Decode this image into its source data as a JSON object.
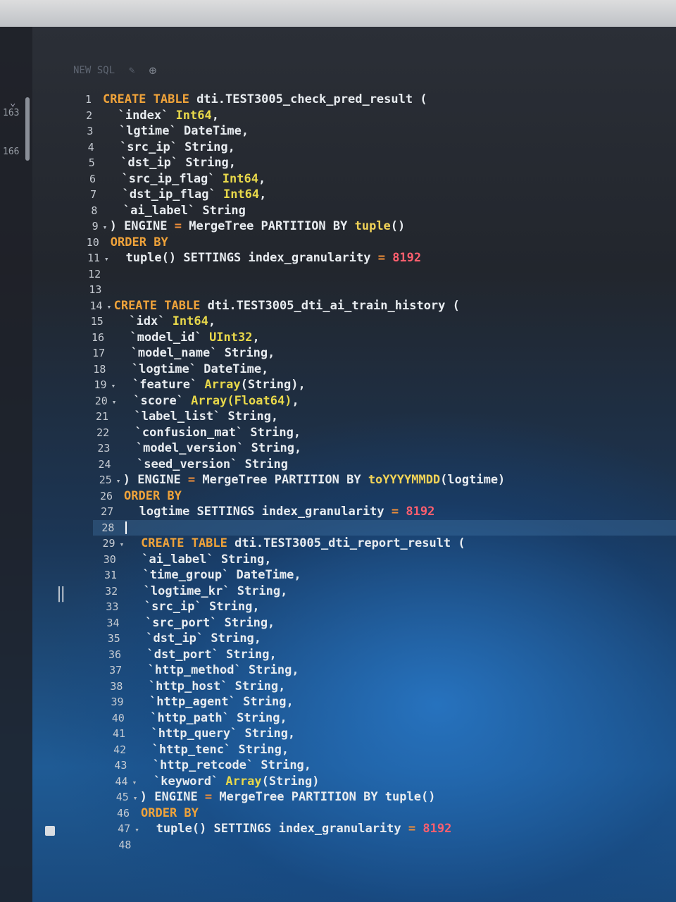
{
  "tab": {
    "label": "NEW SQL",
    "add_icon": "plus-circle-icon"
  },
  "left_panel": {
    "numbers": [
      "163",
      "166"
    ]
  },
  "editor": {
    "lines": [
      {
        "n": "1",
        "fold": "",
        "segs": [
          [
            "kw",
            "CREATE TABLE "
          ],
          [
            "code",
            "dti.TEST3005_check_pred_result ("
          ]
        ]
      },
      {
        "n": "2",
        "fold": "",
        "segs": [
          [
            "code",
            "  `index` "
          ],
          [
            "ty",
            "Int64"
          ],
          [
            "code",
            ","
          ]
        ]
      },
      {
        "n": "3",
        "fold": "",
        "segs": [
          [
            "code",
            "  `lgtime` DateTime,"
          ]
        ]
      },
      {
        "n": "4",
        "fold": "",
        "segs": [
          [
            "code",
            "  `src_ip` String,"
          ]
        ]
      },
      {
        "n": "5",
        "fold": "",
        "segs": [
          [
            "code",
            "  `dst_ip` String,"
          ]
        ]
      },
      {
        "n": "6",
        "fold": "",
        "segs": [
          [
            "code",
            "  `src_ip_flag` "
          ],
          [
            "ty",
            "Int64"
          ],
          [
            "code",
            ","
          ]
        ]
      },
      {
        "n": "7",
        "fold": "",
        "segs": [
          [
            "code",
            "  `dst_ip_flag` "
          ],
          [
            "ty",
            "Int64"
          ],
          [
            "code",
            ","
          ]
        ]
      },
      {
        "n": "8",
        "fold": "",
        "segs": [
          [
            "code",
            "  `ai_label` String"
          ]
        ]
      },
      {
        "n": "9",
        "fold": "▾",
        "segs": [
          [
            "code",
            ") ENGINE "
          ],
          [
            "op",
            "="
          ],
          [
            "code",
            " MergeTree PARTITION BY "
          ],
          [
            "fn",
            "tuple"
          ],
          [
            "code",
            "()"
          ]
        ]
      },
      {
        "n": "10",
        "fold": "",
        "segs": [
          [
            "kw",
            "ORDER BY"
          ]
        ]
      },
      {
        "n": "11",
        "fold": "▾",
        "segs": [
          [
            "code",
            "  tuple() SETTINGS index_granularity "
          ],
          [
            "op",
            "="
          ],
          [
            "num",
            " 8192"
          ]
        ]
      },
      {
        "n": "12",
        "fold": "",
        "segs": []
      },
      {
        "n": "13",
        "fold": "",
        "segs": []
      },
      {
        "n": "14",
        "fold": "▾",
        "segs": [
          [
            "kw",
            "CREATE TABLE "
          ],
          [
            "code",
            "dti.TEST3005_dti_ai_train_history ("
          ]
        ]
      },
      {
        "n": "15",
        "fold": "",
        "segs": [
          [
            "code",
            "  `idx` "
          ],
          [
            "ty",
            "Int64"
          ],
          [
            "code",
            ","
          ]
        ]
      },
      {
        "n": "16",
        "fold": "",
        "segs": [
          [
            "code",
            "  `model_id` "
          ],
          [
            "ty",
            "UInt32"
          ],
          [
            "code",
            ","
          ]
        ]
      },
      {
        "n": "17",
        "fold": "",
        "segs": [
          [
            "code",
            "  `model_name` String,"
          ]
        ]
      },
      {
        "n": "18",
        "fold": "",
        "segs": [
          [
            "code",
            "  `logtime` DateTime,"
          ]
        ]
      },
      {
        "n": "19",
        "fold": "▾",
        "segs": [
          [
            "code",
            "  `feature` "
          ],
          [
            "ty",
            "Array"
          ],
          [
            "code",
            "(String),"
          ]
        ]
      },
      {
        "n": "20",
        "fold": "▾",
        "segs": [
          [
            "code",
            "  `score` "
          ],
          [
            "ty",
            "Array(Float64)"
          ],
          [
            "code",
            ","
          ]
        ]
      },
      {
        "n": "21",
        "fold": "",
        "segs": [
          [
            "code",
            "  `label_list` String,"
          ]
        ]
      },
      {
        "n": "22",
        "fold": "",
        "segs": [
          [
            "code",
            "  `confusion_mat` String,"
          ]
        ]
      },
      {
        "n": "23",
        "fold": "",
        "segs": [
          [
            "code",
            "  `model_version` String,"
          ]
        ]
      },
      {
        "n": "24",
        "fold": "",
        "segs": [
          [
            "code",
            "  `seed_version` String"
          ]
        ]
      },
      {
        "n": "25",
        "fold": "▾",
        "segs": [
          [
            "code",
            ") ENGINE "
          ],
          [
            "op",
            "="
          ],
          [
            "code",
            " MergeTree PARTITION BY "
          ],
          [
            "fn",
            "toYYYYMMDD"
          ],
          [
            "code",
            "(logtime)"
          ]
        ]
      },
      {
        "n": "26",
        "fold": "",
        "segs": [
          [
            "kw",
            "ORDER BY"
          ]
        ]
      },
      {
        "n": "27",
        "fold": "",
        "segs": [
          [
            "code",
            "  logtime SETTINGS index_granularity "
          ],
          [
            "op",
            "="
          ],
          [
            "num",
            " 8192"
          ]
        ]
      },
      {
        "n": "28",
        "fold": "",
        "segs": [],
        "cursor": true
      },
      {
        "n": "29",
        "fold": "▾",
        "segs": [
          [
            "kw",
            "  CREATE TABLE "
          ],
          [
            "code",
            "dti.TEST3005_dti_report_result ("
          ]
        ]
      },
      {
        "n": "30",
        "fold": "",
        "segs": [
          [
            "code",
            "  `ai_label` String,"
          ]
        ]
      },
      {
        "n": "31",
        "fold": "",
        "segs": [
          [
            "code",
            "  `time_group` DateTime,"
          ]
        ]
      },
      {
        "n": "32",
        "fold": "",
        "segs": [
          [
            "code",
            "  `logtime_kr` String,"
          ]
        ]
      },
      {
        "n": "33",
        "fold": "",
        "segs": [
          [
            "code",
            "  `src_ip` String,"
          ]
        ]
      },
      {
        "n": "34",
        "fold": "",
        "segs": [
          [
            "code",
            "  `src_port` String,"
          ]
        ]
      },
      {
        "n": "35",
        "fold": "",
        "segs": [
          [
            "code",
            "  `dst_ip` String,"
          ]
        ]
      },
      {
        "n": "36",
        "fold": "",
        "segs": [
          [
            "code",
            "  `dst_port` String,"
          ]
        ]
      },
      {
        "n": "37",
        "fold": "",
        "segs": [
          [
            "code",
            "  `http_method` String,"
          ]
        ]
      },
      {
        "n": "38",
        "fold": "",
        "segs": [
          [
            "code",
            "  `http_host` String,"
          ]
        ]
      },
      {
        "n": "39",
        "fold": "",
        "segs": [
          [
            "code",
            "  `http_agent` String,"
          ]
        ]
      },
      {
        "n": "40",
        "fold": "",
        "segs": [
          [
            "code",
            "  `http_path` String,"
          ]
        ]
      },
      {
        "n": "41",
        "fold": "",
        "segs": [
          [
            "code",
            "  `http_query` String,"
          ]
        ]
      },
      {
        "n": "42",
        "fold": "",
        "segs": [
          [
            "code",
            "  `http_tenc` String,"
          ]
        ]
      },
      {
        "n": "43",
        "fold": "",
        "segs": [
          [
            "code",
            "  `http_retcode` String,"
          ]
        ]
      },
      {
        "n": "44",
        "fold": "▾",
        "segs": [
          [
            "code",
            "  `keyword` "
          ],
          [
            "ty",
            "Array"
          ],
          [
            "code",
            "(String)"
          ]
        ]
      },
      {
        "n": "45",
        "fold": "▾",
        "segs": [
          [
            "code",
            ") ENGINE "
          ],
          [
            "op",
            "="
          ],
          [
            "code",
            " MergeTree PARTITION BY tuple()"
          ]
        ]
      },
      {
        "n": "46",
        "fold": "",
        "segs": [
          [
            "kw",
            "ORDER BY"
          ]
        ]
      },
      {
        "n": "47",
        "fold": "▾",
        "segs": [
          [
            "code",
            "  tuple() SETTINGS index_granularity "
          ],
          [
            "op",
            "="
          ],
          [
            "num",
            " 8192"
          ]
        ]
      },
      {
        "n": "48",
        "fold": "",
        "segs": []
      }
    ]
  }
}
